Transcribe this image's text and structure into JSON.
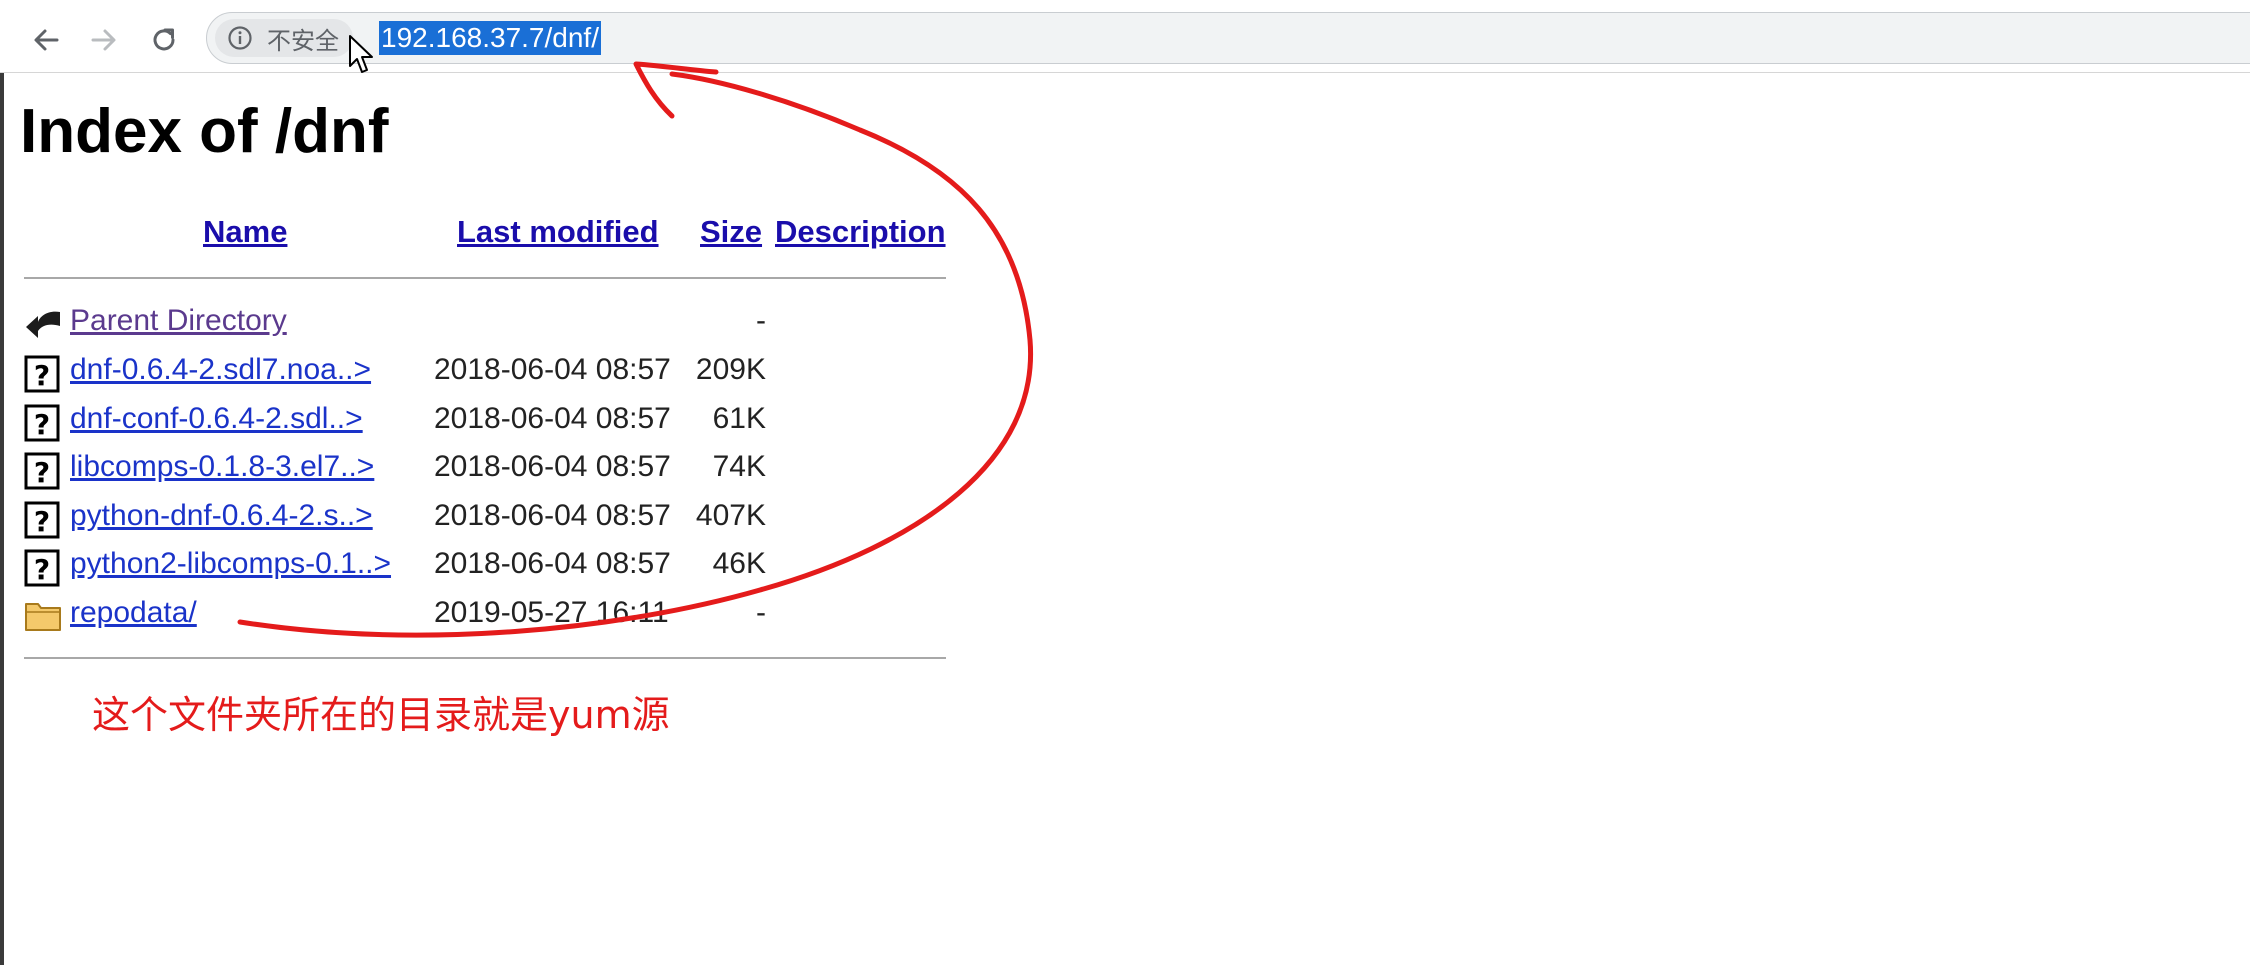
{
  "browser": {
    "security_label": "不安全",
    "url": "192.168.37.7/dnf/",
    "icons": {
      "back": "arrow-left-icon",
      "forward": "arrow-right-icon",
      "reload": "reload-icon",
      "security": "info-circle-icon",
      "cursor": "mouse-pointer-icon"
    }
  },
  "page": {
    "title": "Index of /dnf",
    "columns": {
      "name": "Name",
      "last_modified": "Last modified",
      "size": "Size",
      "description": "Description"
    },
    "entries": [
      {
        "icon": "back-arrow-icon",
        "name": "Parent Directory",
        "modified": "",
        "size": "-"
      },
      {
        "icon": "unknown-file-icon",
        "name": "dnf-0.6.4-2.sdl7.noa..>",
        "modified": "2018-06-04 08:57",
        "size": "209K"
      },
      {
        "icon": "unknown-file-icon",
        "name": "dnf-conf-0.6.4-2.sdl..>",
        "modified": "2018-06-04 08:57",
        "size": "61K"
      },
      {
        "icon": "unknown-file-icon",
        "name": "libcomps-0.1.8-3.el7..>",
        "modified": "2018-06-04 08:57",
        "size": "74K"
      },
      {
        "icon": "unknown-file-icon",
        "name": "python-dnf-0.6.4-2.s..>",
        "modified": "2018-06-04 08:57",
        "size": "407K"
      },
      {
        "icon": "unknown-file-icon",
        "name": "python2-libcomps-0.1..>",
        "modified": "2018-06-04 08:57",
        "size": "46K"
      },
      {
        "icon": "folder-icon",
        "name": "repodata/",
        "modified": "2019-05-27 16:11",
        "size": "-"
      }
    ]
  },
  "annotation": {
    "text": "这个文件夹所在的目录就是yum源",
    "color": "#e41b1b"
  },
  "colors": {
    "link": "#1a33c9",
    "visited_link": "#5b3a8e",
    "url_highlight": "#1a6fd6",
    "annotation": "#e41b1b"
  }
}
